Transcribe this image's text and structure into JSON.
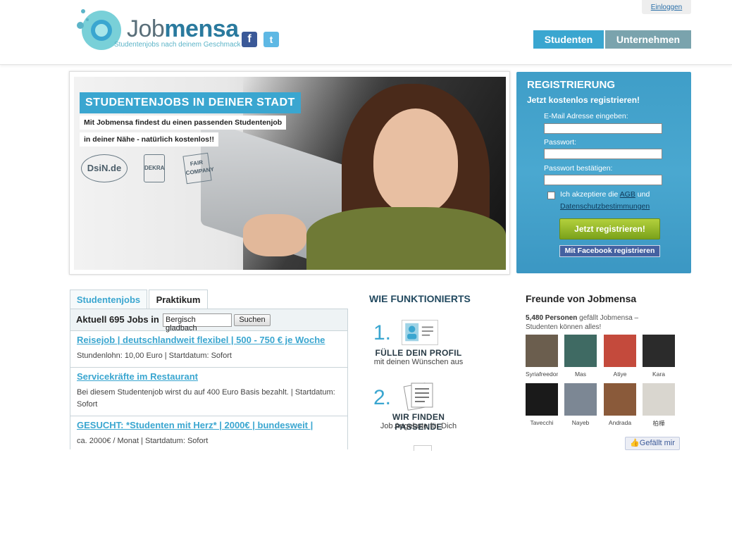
{
  "header": {
    "logo_text_light": "Job",
    "logo_text_bold": "mensa",
    "logo_tagline": "Studentenjobs nach deinem Geschmack",
    "facebook_icon": "f",
    "twitter_icon": "t",
    "login_label": "Einloggen",
    "tabs": [
      {
        "label": "Studenten",
        "active": true
      },
      {
        "label": "Unternehmen",
        "active": false
      }
    ],
    "colors": {
      "accent": "#3aa6d0",
      "secondary": "#7aa3ad"
    }
  },
  "hero": {
    "title": "STUDENTENJOBS IN DEINER STADT",
    "line1": "Mit Jobmensa findest du einen passenden Studentenjob",
    "line2": "in deiner Nähe - natürlich kostenlos!!",
    "badges": [
      "DsiN.de",
      "DEKRA",
      "FAIR COMPANY"
    ]
  },
  "registration": {
    "title": "REGISTRIERUNG",
    "subtitle": "Jetzt kostenlos registrieren!",
    "email_label": "E-Mail Adresse eingeben:",
    "password_label": "Passwort:",
    "password_confirm_label": "Passwort bestätigen:",
    "accept_prefix": "Ich akzeptiere die",
    "agb_link": "AGB",
    "accept_and": "und",
    "privacy_link": "Datenschutzbestimmungen",
    "submit_label": "Jetzt registrieren!",
    "facebook_label": "Mit Facebook registrieren"
  },
  "jobs": {
    "tabs": [
      "Studentenjobs",
      "Praktikum"
    ],
    "current_label": "Aktuell 695 Jobs in",
    "city_value": "Bergisch gladbach",
    "search_label": "Suchen",
    "items": [
      {
        "title": "Reisejob | deutschlandweit flexibel | 500 - 750 € je Woche",
        "desc": "Stundenlohn: 10,00 Euro | Startdatum: Sofort"
      },
      {
        "title": "Servicekräfte im Restaurant",
        "desc": "Bei diesem Studentenjob wirst du auf 400 Euro Basis bezahlt. | Startdatum: Sofort"
      },
      {
        "title": "GESUCHT: *Studenten mit Herz* | 2000€ | bundesweit |",
        "desc": "ca. 2000€ / Monat | Startdatum: Sofort"
      }
    ]
  },
  "how": {
    "title": "WIE FUNKTIONIERTS",
    "steps": [
      {
        "num": "1.",
        "title": "FÜLLE DEIN PROFIL",
        "sub": "mit deinen Wünschen aus",
        "icon": "profile-card-icon"
      },
      {
        "num": "2.",
        "title": "WIR FINDEN PASSENDE",
        "sub": "Job Angebote für Dich",
        "icon": "documents-icon"
      }
    ]
  },
  "friends": {
    "title": "Freunde von Jobmensa",
    "likes_count": "5,480 Personen",
    "likes_text": "gefällt Jobmensa – Studenten können alles!",
    "people": [
      {
        "name": "Syriafreedom",
        "color": "#6b5e4e"
      },
      {
        "name": "Mas",
        "color": "#3f6a63"
      },
      {
        "name": "Atiye",
        "color": "#c44a3c"
      },
      {
        "name": "Kara",
        "color": "#2b2b2b"
      },
      {
        "name": "Tavecchi",
        "color": "#1a1a1a"
      },
      {
        "name": "Nayeb",
        "color": "#7c8794"
      },
      {
        "name": "Andrada",
        "color": "#8a5a3a"
      },
      {
        "name": "柏樺",
        "color": "#d9d6cf"
      }
    ],
    "like_button": "Gefällt mir"
  }
}
